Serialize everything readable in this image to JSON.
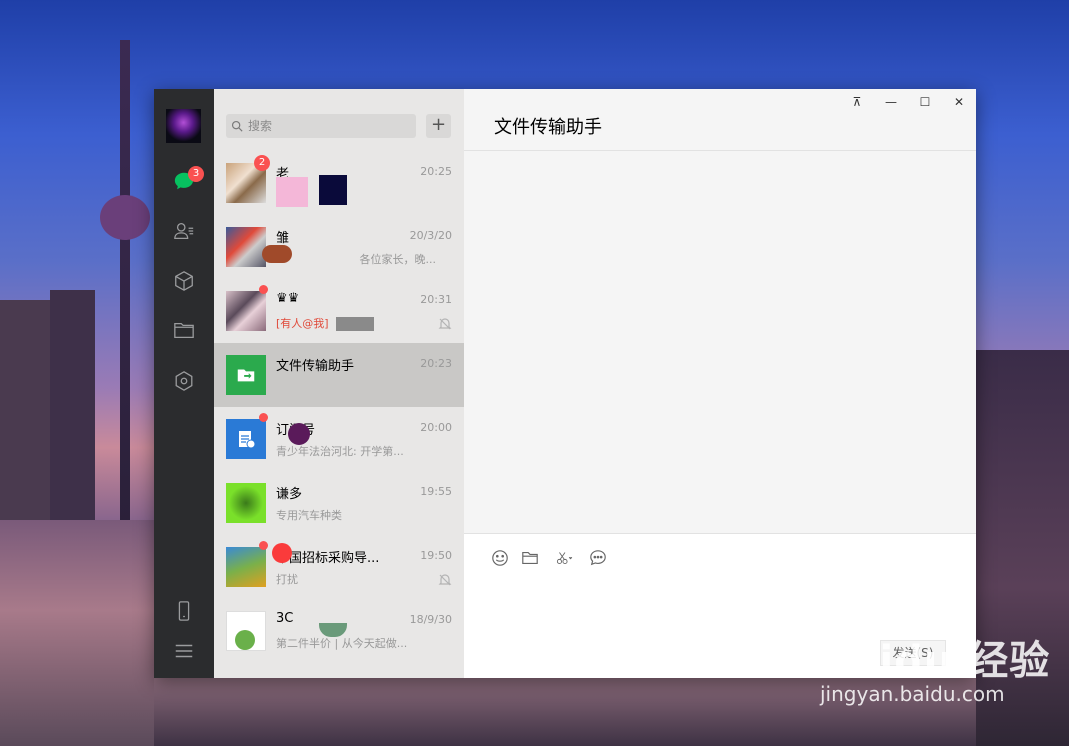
{
  "chat_window": {
    "search": {
      "placeholder": "搜索"
    },
    "add_label": "+",
    "rail_badge": "3",
    "conversations": [
      {
        "name": "老",
        "time": "20:25",
        "preview": "",
        "badge": "2",
        "muted": false
      },
      {
        "name": "雏",
        "time": "20/3/20",
        "preview": "各位家长，晚...",
        "badge": "",
        "muted": false
      },
      {
        "name": "♛♛",
        "time": "20:31",
        "preview": "[有人@我]",
        "badge": "dot",
        "muted": true
      },
      {
        "name": "文件传输助手",
        "time": "20:23",
        "preview": "",
        "badge": "",
        "muted": false
      },
      {
        "name": "订阅号",
        "time": "20:00",
        "preview": "青少年法治河北: 开学第...",
        "badge": "dot",
        "muted": false
      },
      {
        "name": "谦多",
        "time": "19:55",
        "preview": "专用汽车种类",
        "badge": "",
        "muted": false
      },
      {
        "name": "中国招标采购导...",
        "time": "19:50",
        "preview": "打扰",
        "badge": "dot",
        "muted": true
      },
      {
        "name": "3C",
        "time": "18/9/30",
        "preview": "第二件半价 | 从今天起做...",
        "badge": "",
        "muted": false
      }
    ],
    "title": "文件传输助手",
    "window_controls": {
      "pin": "⊼",
      "minimize": "—",
      "maximize": "☐",
      "close": "✕"
    },
    "send_label": "发送(S)"
  },
  "watermark": {
    "brand": "Baidu 经验",
    "url": "jingyan.baidu.com"
  },
  "colors": {
    "accent": "#07c160",
    "badge": "#fa5151",
    "rail": "#2b2c2e",
    "list_bg": "#e8e7e6"
  }
}
